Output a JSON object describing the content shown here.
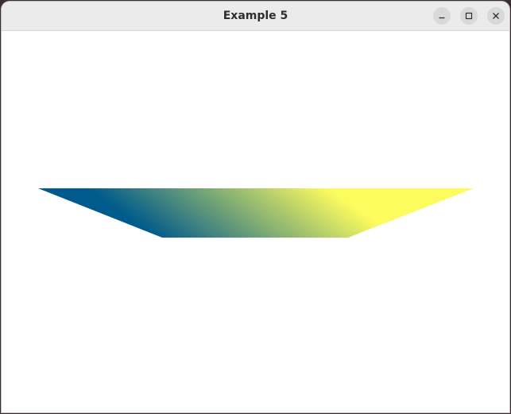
{
  "window": {
    "title": "Example 5",
    "controls": {
      "minimize_icon": "minimize-icon",
      "maximize_icon": "maximize-icon",
      "close_icon": "close-icon"
    }
  },
  "canvas": {
    "background": "#ffffff",
    "shape": {
      "kind": "trapezoid",
      "gradient_colors": [
        "#005a8c",
        "#fdfc5e"
      ]
    }
  }
}
